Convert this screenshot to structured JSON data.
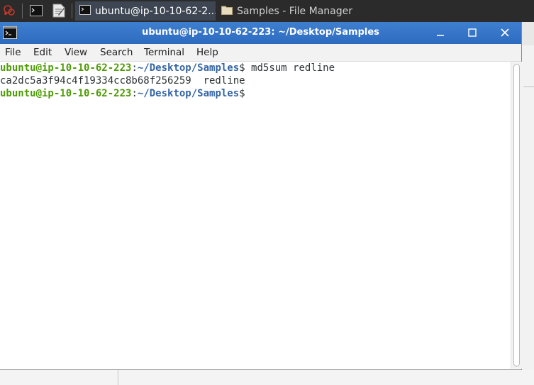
{
  "taskbar": {
    "tasks": [
      {
        "label": "ubuntu@ip-10-10-62-2...",
        "active": true,
        "icon": "terminal-icon"
      },
      {
        "label": "Samples - File Manager",
        "active": false,
        "icon": "folder-icon"
      }
    ],
    "launchers": [
      "app-menu-icon",
      "terminal-launcher-icon",
      "text-editor-launcher-icon"
    ]
  },
  "window": {
    "title": "ubuntu@ip-10-10-62-223: ~/Desktop/Samples",
    "controls": [
      "minimize",
      "maximize",
      "close"
    ]
  },
  "menu": {
    "file": "File",
    "edit": "Edit",
    "view": "View",
    "search": "Search",
    "terminal": "Terminal",
    "help": "Help"
  },
  "terminal": {
    "line1": {
      "user": "ubuntu@ip-10-10-62-223",
      "sep": ":",
      "path": "~/Desktop/Samples",
      "prompt": "$",
      "command": " md5sum redline"
    },
    "line2": {
      "output": "ca2dc5a3f94c4f19334cc8b68f256259  redline"
    },
    "line3": {
      "user": "ubuntu@ip-10-10-62-223",
      "sep": ":",
      "path": "~/Desktop/Samples",
      "prompt": "$"
    }
  },
  "colors": {
    "prompt_user": "#4e9a06",
    "prompt_path": "#3465a4",
    "titlebar": "#3f7fcf",
    "taskbar": "#2b2b2b"
  }
}
